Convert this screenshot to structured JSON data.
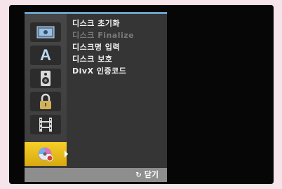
{
  "menu": {
    "icons": [
      {
        "name": "disc-icon"
      },
      {
        "name": "letter-a-icon",
        "glyph": "A"
      },
      {
        "name": "speaker-icon"
      },
      {
        "name": "lock-icon"
      },
      {
        "name": "film-icon"
      },
      {
        "name": "disc-settings-icon",
        "selected": true
      }
    ],
    "items": [
      {
        "label": "디스크 초기화",
        "enabled": true
      },
      {
        "label": "디스크 Finalize",
        "enabled": false
      },
      {
        "label": "디스크명 입력",
        "enabled": true
      },
      {
        "label": "디스크 보호",
        "enabled": true
      },
      {
        "label": "DivX 인증코드",
        "enabled": true
      }
    ]
  },
  "footer": {
    "close_icon": "return-icon",
    "close_label": "닫기"
  },
  "colors": {
    "accent_bar": "#6aa0c8",
    "selection": "#f0c220"
  }
}
